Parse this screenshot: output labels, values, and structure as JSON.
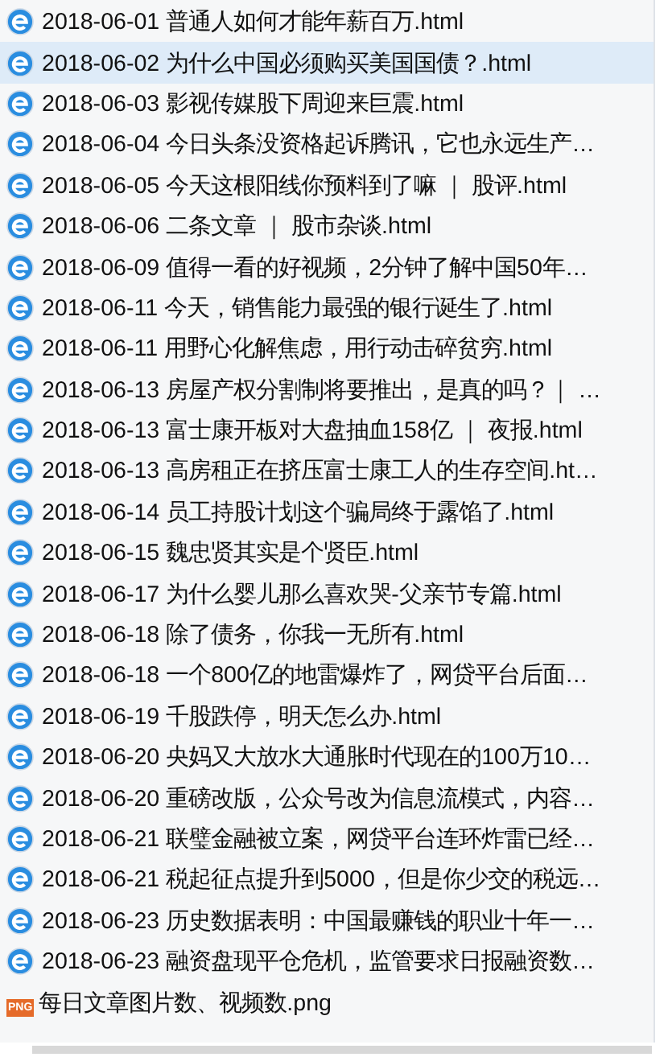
{
  "files": [
    {
      "kind": "html",
      "name": "2018-06-01 普通人如何才能年薪百万.html",
      "selected": false
    },
    {
      "kind": "html",
      "name": "2018-06-02 为什么中国必须购买美国国债？.html",
      "selected": true
    },
    {
      "kind": "html",
      "name": "2018-06-03 影视传媒股下周迎来巨震.html",
      "selected": false
    },
    {
      "kind": "html",
      "name": "2018-06-04 今日头条没资格起诉腾讯，它也永远生产…",
      "selected": false
    },
    {
      "kind": "html",
      "name": "2018-06-05 今天这根阳线你预料到了嘛 ｜ 股评.html",
      "selected": false
    },
    {
      "kind": "html",
      "name": "2018-06-06 二条文章 ｜ 股市杂谈.html",
      "selected": false
    },
    {
      "kind": "html",
      "name": "2018-06-09 值得一看的好视频，2分钟了解中国50年…",
      "selected": false
    },
    {
      "kind": "html",
      "name": "2018-06-11 今天，销售能力最强的银行诞生了.html",
      "selected": false
    },
    {
      "kind": "html",
      "name": "2018-06-11 用野心化解焦虑，用行动击碎贫穷.html",
      "selected": false
    },
    {
      "kind": "html",
      "name": "2018-06-13 房屋产权分割制将要推出，是真的吗？｜ …",
      "selected": false
    },
    {
      "kind": "html",
      "name": "2018-06-13 富士康开板对大盘抽血158亿 ｜ 夜报.html",
      "selected": false
    },
    {
      "kind": "html",
      "name": "2018-06-13 高房租正在挤压富士康工人的生存空间.ht…",
      "selected": false
    },
    {
      "kind": "html",
      "name": "2018-06-14 员工持股计划这个骗局终于露馅了.html",
      "selected": false
    },
    {
      "kind": "html",
      "name": "2018-06-15 魏忠贤其实是个贤臣.html",
      "selected": false
    },
    {
      "kind": "html",
      "name": "2018-06-17 为什么婴儿那么喜欢哭-父亲节专篇.html",
      "selected": false
    },
    {
      "kind": "html",
      "name": "2018-06-18 除了债务，你我一无所有.html",
      "selected": false
    },
    {
      "kind": "html",
      "name": "2018-06-18 一个800亿的地雷爆炸了，网贷平台后面…",
      "selected": false
    },
    {
      "kind": "html",
      "name": "2018-06-19 千股跌停，明天怎么办.html",
      "selected": false
    },
    {
      "kind": "html",
      "name": "2018-06-20 央妈又大放水大通胀时代现在的100万10…",
      "selected": false
    },
    {
      "kind": "html",
      "name": "2018-06-20 重磅改版，公众号改为信息流模式，内容…",
      "selected": false
    },
    {
      "kind": "html",
      "name": "2018-06-21 联璧金融被立案，网贷平台连环炸雷已经…",
      "selected": false
    },
    {
      "kind": "html",
      "name": "2018-06-21 税起征点提升到5000，但是你少交的税远…",
      "selected": false
    },
    {
      "kind": "html",
      "name": "2018-06-23 历史数据表明：中国最赚钱的职业十年一…",
      "selected": false
    },
    {
      "kind": "html",
      "name": "2018-06-23 融资盘现平仓危机，监管要求日报融资数…",
      "selected": false
    },
    {
      "kind": "png",
      "icon_text": "PNG",
      "name": "每日文章图片数、视频数.png",
      "selected": false
    }
  ]
}
